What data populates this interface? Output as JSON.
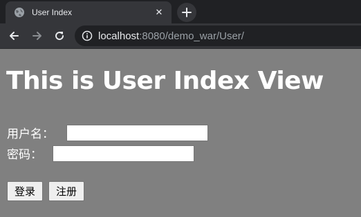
{
  "browser": {
    "tab": {
      "title": "User Index",
      "close_glyph": "✕"
    },
    "new_tab_glyph": "+",
    "address": {
      "host": "localhost",
      "rest": ":8080/demo_war/User/"
    },
    "icons": {
      "favicon": "globe-icon",
      "back": "arrow-left-icon",
      "forward": "arrow-right-icon",
      "reload": "reload-icon",
      "info": "info-icon"
    }
  },
  "page": {
    "heading": "This is User Index View",
    "username_label": "用户名：",
    "username_value": "",
    "password_label": "密码：",
    "password_value": "",
    "login_button": "登录",
    "register_button": "注册"
  },
  "colors": {
    "page_background": "#808080",
    "chrome_dark": "#202124",
    "chrome_toolbar": "#35363a"
  }
}
